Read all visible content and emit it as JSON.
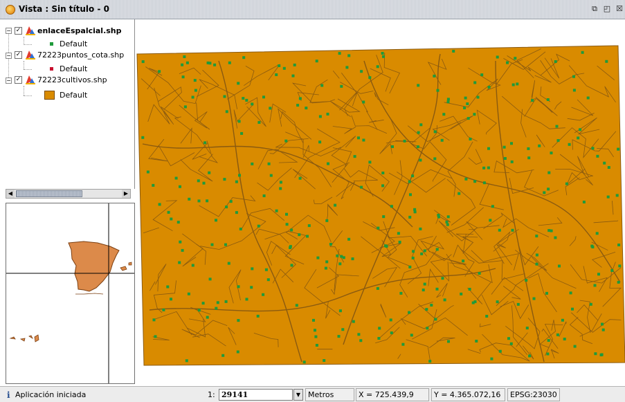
{
  "window": {
    "title": "Vista : Sin título - 0",
    "buttons": [
      "restore-icon",
      "maximize-icon",
      "close-icon"
    ]
  },
  "layers": [
    {
      "name": "enlaceEspalcial.shp",
      "bold": true,
      "checked": true,
      "legend": {
        "label": "Default",
        "color": "#1f9a3b",
        "shape": "point"
      }
    },
    {
      "name": "72223puntos_cota.shp",
      "bold": false,
      "checked": true,
      "legend": {
        "label": "Default",
        "color": "#c8102e",
        "shape": "point"
      }
    },
    {
      "name": "72223cultivos.shp",
      "bold": false,
      "checked": true,
      "legend": {
        "label": "Default",
        "color": "#d98b00",
        "shape": "polygon"
      }
    }
  ],
  "map": {
    "fill_color": "#d98b00",
    "stroke_color": "#8a5a10",
    "point_color": "#1f9a3b"
  },
  "locator": {
    "land_color": "#dc8a4a"
  },
  "status": {
    "message": "Aplicación iniciada",
    "scale_prefix": "1:",
    "scale_value": "29141",
    "units": "Metros",
    "x": "X = 725.439,9",
    "y": "Y = 4.365.072,16",
    "crs": "EPSG:23030"
  }
}
